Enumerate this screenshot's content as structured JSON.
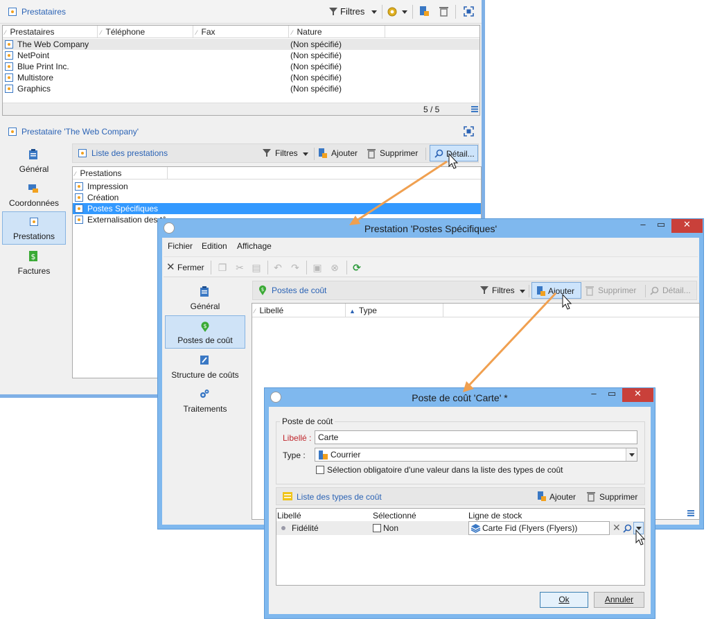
{
  "main": {
    "header": {
      "title": "Prestataires",
      "filters_label": "Filtres"
    },
    "grid": {
      "columns": [
        "Prestataires",
        "Téléphone",
        "Fax",
        "Nature"
      ],
      "rows": [
        {
          "name": "The Web Company",
          "nature": "(Non spécifié)"
        },
        {
          "name": "NetPoint",
          "nature": "(Non spécifié)"
        },
        {
          "name": "Blue Print Inc.",
          "nature": "(Non spécifié)"
        },
        {
          "name": "Multistore",
          "nature": "(Non spécifié)"
        },
        {
          "name": "Graphics",
          "nature": "(Non spécifié)"
        }
      ],
      "count": "5 / 5"
    },
    "detail": {
      "title": "Prestataire 'The Web Company'"
    },
    "nav": [
      {
        "label": "Général"
      },
      {
        "label": "Coordonnées"
      },
      {
        "label": "Prestations"
      },
      {
        "label": "Factures"
      }
    ],
    "list_toolbar": {
      "title": "Liste des prestations",
      "filters": "Filtres",
      "add": "Ajouter",
      "delete": "Supprimer",
      "detail": "Détail..."
    },
    "list": {
      "column": "Prestations",
      "rows": [
        "Impression",
        "Création",
        "Postes Spécifiques",
        "Externalisation des tâ..."
      ]
    }
  },
  "dialog1": {
    "title": "Prestation 'Postes Spécifiques'",
    "menu": [
      "Fichier",
      "Edition",
      "Affichage"
    ],
    "close_label": "Fermer",
    "nav": [
      {
        "label": "Général"
      },
      {
        "label": "Postes de coût"
      },
      {
        "label": "Structure de coûts"
      },
      {
        "label": "Traitements"
      }
    ],
    "toolbar": {
      "title": "Postes de coût",
      "filters": "Filtres",
      "add": "Ajouter",
      "delete": "Supprimer",
      "detail": "Détail..."
    },
    "grid": {
      "columns": [
        "Libellé",
        "Type"
      ]
    }
  },
  "dialog2": {
    "title": "Poste de coût 'Carte' *",
    "group_label": "Poste de coût",
    "libelle_label": "Libellé :",
    "libelle_value": "Carte",
    "type_label": "Type :",
    "type_value": "Courrier",
    "checkbox_label": "Sélection obligatoire d'une valeur dans la liste des types de coût",
    "list": {
      "title": "Liste des types de coût",
      "add": "Ajouter",
      "delete": "Supprimer",
      "columns": [
        "Libellé",
        "Sélectionné",
        "Ligne de stock"
      ],
      "row": {
        "libelle": "Fidélité",
        "selected": "Non",
        "stock": "Carte Fid (Flyers (Flyers))"
      }
    },
    "ok": "Ok",
    "cancel": "Annuler"
  },
  "colors": {
    "accent": "#2b63b5",
    "selection": "#3399ff",
    "arrow": "#f0a050",
    "window_frame": "#7fb8ee",
    "close_button": "#c9403a",
    "required_label": "#c0272d"
  }
}
